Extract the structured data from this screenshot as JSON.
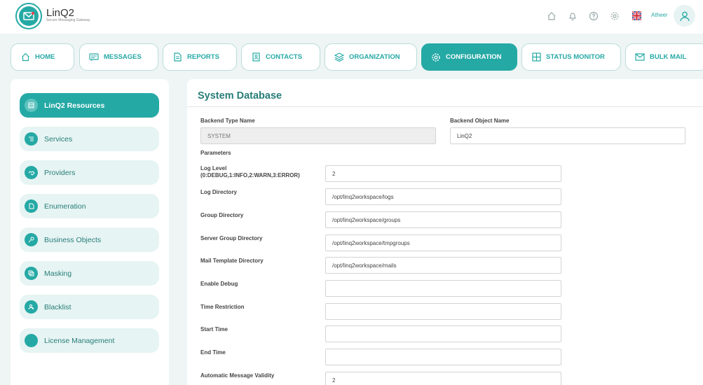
{
  "header": {
    "app_name": "LinQ2",
    "tagline": "Secure Messaging Gateway",
    "user_name": "Atheer",
    "icons": [
      "home-outline-icon",
      "bell-icon",
      "help-icon",
      "gear-icon",
      "uk-flag-icon",
      "user-icon"
    ]
  },
  "nav": {
    "tabs": [
      {
        "label": "HOME",
        "icon": "home-icon"
      },
      {
        "label": "MESSAGES",
        "icon": "message-icon"
      },
      {
        "label": "REPORTS",
        "icon": "report-icon"
      },
      {
        "label": "CONTACTS",
        "icon": "contact-icon"
      },
      {
        "label": "ORGANIZATION",
        "icon": "layers-icon"
      },
      {
        "label": "CONFIGURATION",
        "icon": "gear-icon",
        "active": true
      },
      {
        "label": "STATUS MONITOR",
        "icon": "grid-icon"
      },
      {
        "label": "BULK MAIL",
        "icon": "mail-icon"
      }
    ]
  },
  "sidebar": {
    "items": [
      {
        "label": "LinQ2 Resources",
        "icon": "database-icon",
        "active": true
      },
      {
        "label": "Services",
        "icon": "list-icon"
      },
      {
        "label": "Providers",
        "icon": "handshake-icon"
      },
      {
        "label": "Enumeration",
        "icon": "document-icon"
      },
      {
        "label": "Business Objects",
        "icon": "key-icon"
      },
      {
        "label": "Masking",
        "icon": "copy-icon"
      },
      {
        "label": "Blacklist",
        "icon": "block-user-icon"
      },
      {
        "label": "License Management",
        "icon": "license-icon"
      }
    ]
  },
  "main": {
    "title": "System Database",
    "backend_type_label": "Backend Type Name",
    "backend_type_value": "SYSTEM",
    "backend_object_label": "Backend Object Name",
    "backend_object_value": "LinQ2",
    "parameters_label": "Parameters",
    "params": [
      {
        "label": "Log Level",
        "sublabel": "(0:DEBUG,1:INFO,2:WARN,3:ERROR)",
        "value": "2"
      },
      {
        "label": "Log Directory",
        "value": "/opt/linq2workspace/logs"
      },
      {
        "label": "Group Directory",
        "value": "/opt/linq2workspace/groups"
      },
      {
        "label": "Server Group Directory",
        "value": "/opt/linq2workspace/tmpgroups"
      },
      {
        "label": "Mail Template Directory",
        "value": "/opt/linq2workspace/mails"
      },
      {
        "label": "Enable Debug",
        "value": ""
      },
      {
        "label": "Time Restriction",
        "value": ""
      },
      {
        "label": "Start Time",
        "value": ""
      },
      {
        "label": "End Time",
        "value": ""
      },
      {
        "label": "Automatic Message Validity",
        "value": "2"
      }
    ]
  },
  "colors": {
    "accent": "#25a9a5",
    "accent_dark": "#277d78",
    "background": "#eef5f4"
  }
}
